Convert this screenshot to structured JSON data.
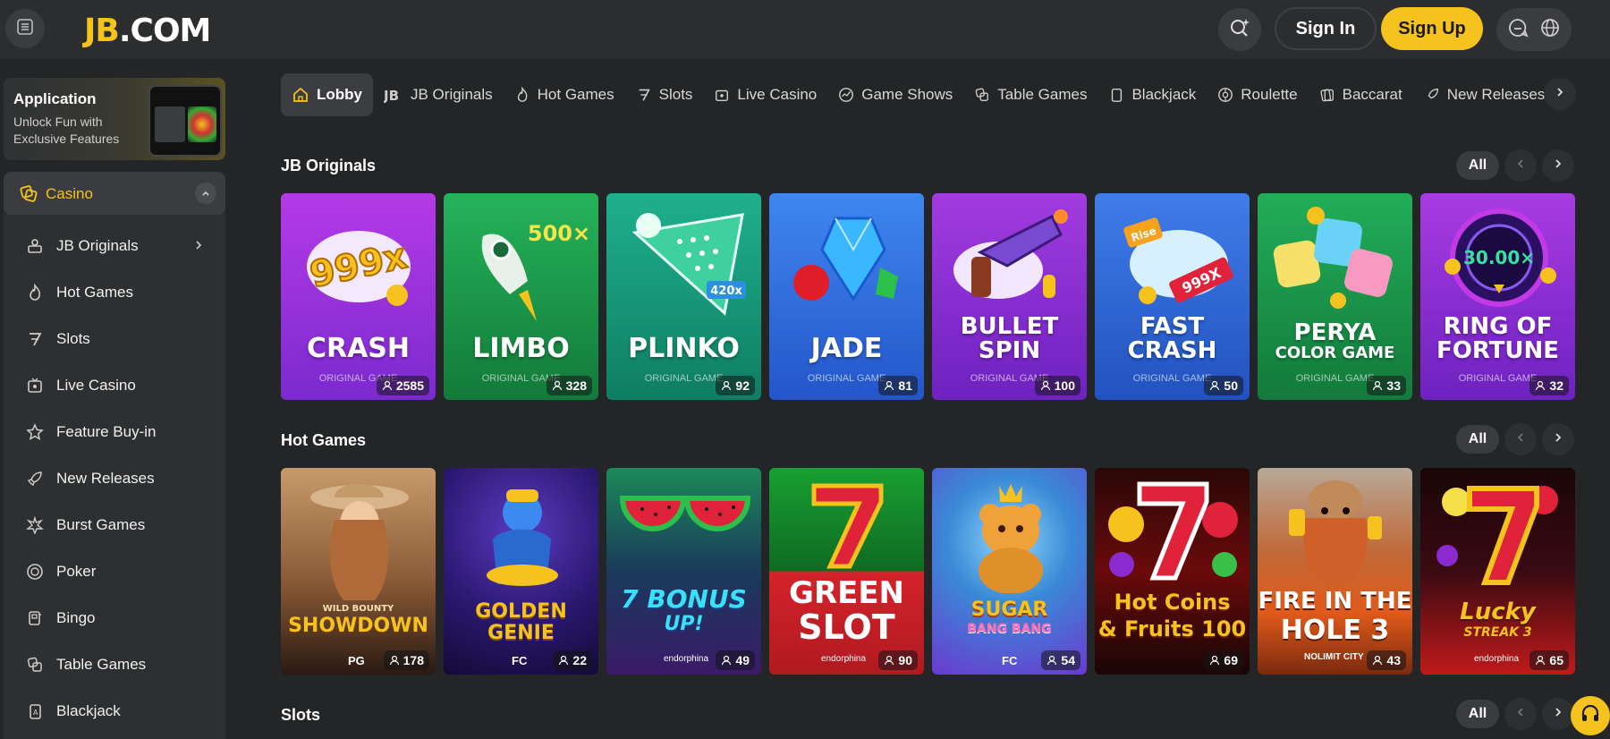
{
  "header": {
    "logo_jb": "JB",
    "logo_rest": ".COM",
    "signin_label": "Sign In",
    "signup_label": "Sign Up",
    "icons": [
      "menu-icon",
      "search-icon",
      "chat-icon",
      "globe-icon"
    ]
  },
  "app_promo": {
    "title": "Application",
    "subtitle": "Unlock Fun with Exclusive Features"
  },
  "sidebar": {
    "casino_label": "Casino",
    "items": [
      {
        "label": "JB Originals"
      },
      {
        "label": "Hot Games"
      },
      {
        "label": "Slots"
      },
      {
        "label": "Live Casino"
      },
      {
        "label": "Feature Buy-in"
      },
      {
        "label": "New Releases"
      },
      {
        "label": "Burst Games"
      },
      {
        "label": "Poker"
      },
      {
        "label": "Bingo"
      },
      {
        "label": "Table Games"
      },
      {
        "label": "Blackjack"
      }
    ]
  },
  "tabs": [
    {
      "label": "Lobby"
    },
    {
      "label": "JB Originals"
    },
    {
      "label": "Hot Games"
    },
    {
      "label": "Slots"
    },
    {
      "label": "Live Casino"
    },
    {
      "label": "Game Shows"
    },
    {
      "label": "Table Games"
    },
    {
      "label": "Blackjack"
    },
    {
      "label": "Roulette"
    },
    {
      "label": "Baccarat"
    },
    {
      "label": "New Releases"
    }
  ],
  "sections": {
    "originals": {
      "title": "JB Originals",
      "all_label": "All",
      "games": [
        {
          "name1": "CRASH",
          "name2": "",
          "sub": "ORIGINAL GAME",
          "players": "2585",
          "color1": "#b53ae6",
          "color2": "#7b2ad0"
        },
        {
          "name1": "LIMBO",
          "name2": "",
          "sub": "ORIGINAL GAME",
          "players": "328",
          "color1": "#25b35a",
          "color2": "#127a3a"
        },
        {
          "name1": "PLINKO",
          "name2": "",
          "sub": "ORIGINAL GAME",
          "players": "92",
          "color1": "#1fb08e",
          "color2": "#0f7d63"
        },
        {
          "name1": "JADE",
          "name2": "",
          "sub": "ORIGINAL GAME",
          "players": "81",
          "color1": "#3f86ef",
          "color2": "#2456c9"
        },
        {
          "name1": "BULLET",
          "name2": "SPIN",
          "sub": "ORIGINAL GAME",
          "players": "100",
          "color1": "#a23be0",
          "color2": "#6e22c0"
        },
        {
          "name1": "FAST",
          "name2": "CRASH",
          "sub": "ORIGINAL GAME",
          "players": "50",
          "color1": "#3f7de8",
          "color2": "#2252c0"
        },
        {
          "name1": "PERYA",
          "name2": "COLOR GAME",
          "sub": "ORIGINAL GAME",
          "players": "33",
          "color1": "#22ad58",
          "color2": "#137a3b"
        },
        {
          "name1": "RING OF",
          "name2": "FORTUNE",
          "sub": "ORIGINAL GAME",
          "players": "32",
          "color1": "#a83be2",
          "color2": "#6e22c0"
        }
      ]
    },
    "hot": {
      "title": "Hot Games",
      "all_label": "All",
      "games": [
        {
          "name1": "SHOWDOWN",
          "name2": "WILD BOUNTY",
          "studio": "PG",
          "players": "178",
          "color1": "#b07a4a",
          "color2": "#3a2216"
        },
        {
          "name1": "GOLDEN",
          "name2": "GENIE",
          "studio": "FC",
          "players": "22",
          "color1": "#3c2a8a",
          "color2": "#1a1248"
        },
        {
          "name1": "7 BONUS",
          "name2": "UP!",
          "studio": "endorphina",
          "players": "49",
          "color1": "#1c8a5a",
          "color2": "#5a1a7a"
        },
        {
          "name1": "GREEN",
          "name2": "SLOT",
          "studio": "endorphina",
          "players": "90",
          "color1": "#1fa33a",
          "color2": "#d5232a"
        },
        {
          "name1": "SUGAR",
          "name2": "BANG BANG",
          "studio": "FC",
          "players": "54",
          "color1": "#3ea6e6",
          "color2": "#8a3ed6"
        },
        {
          "name1": "Hot Coins",
          "name2": "& Fruits 100",
          "studio": "",
          "players": "69",
          "color1": "#d5201e",
          "color2": "#2a0a0a"
        },
        {
          "name1": "FIRE IN THE",
          "name2": "HOLE 3",
          "studio": "NOLIMIT CITY",
          "players": "43",
          "color1": "#e05a1a",
          "color2": "#7a2a0e"
        },
        {
          "name1": "Lucky",
          "name2": "STREAK 3",
          "studio": "endorphina",
          "players": "65",
          "color1": "#2a0a10",
          "color2": "#c01a1a"
        }
      ]
    },
    "slots": {
      "title": "Slots",
      "all_label": "All"
    }
  }
}
